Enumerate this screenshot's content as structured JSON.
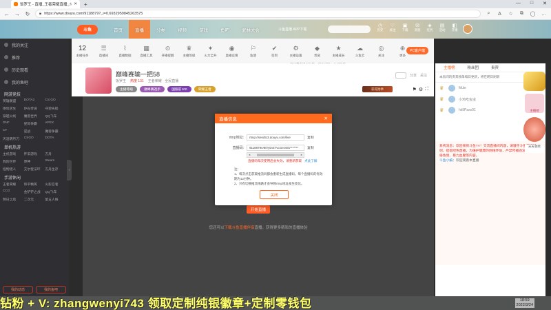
{
  "browser": {
    "tab_title": "饭罗王 - 直播_王者荣耀直播_斗鱼",
    "url": "https://www.douyu.com/9118879?_i=0.6932959845263575",
    "new_tab": "+",
    "minimize": "—",
    "maximize": "□",
    "close": "✕"
  },
  "site": {
    "logo": "斗鱼",
    "nav": [
      "首页",
      "直播",
      "分类",
      "视频",
      "游戏",
      "鱼吧",
      "武林大会"
    ],
    "download_label": "斗鱼直播 APP下载",
    "search_placeholder": "",
    "header_icons": [
      {
        "glyph": "◷",
        "label": "历史"
      },
      {
        "glyph": "♡",
        "label": "关注"
      },
      {
        "glyph": "▣",
        "label": "下载"
      },
      {
        "glyph": "✉",
        "label": "消息"
      },
      {
        "glyph": "◈",
        "label": "任务"
      },
      {
        "glyph": "▤",
        "label": "活动"
      },
      {
        "glyph": "◧",
        "label": "开播"
      }
    ]
  },
  "sidebar": {
    "items": [
      "我的关注",
      "推荐",
      "历史观看",
      "我的鱼吧"
    ],
    "section1": "网游竞技",
    "grid1": [
      "英雄联盟",
      "DOTA2",
      "CS:GO",
      "绝地求生",
      "炉石传说",
      "守望先锋",
      "穿越火线",
      "魔兽世界",
      "QQ飞车",
      "DNF",
      "星际争霸",
      "APEX",
      "CF",
      "逆战",
      "魔兽争霸",
      "天涯明月刀",
      "CSGO",
      "DOTA"
    ],
    "section2": "单机热游",
    "grid2": [
      "主机游戏",
      "怀旧游戏",
      "方舟",
      "我的世界",
      "原神",
      "Steam",
      "怪物猎人",
      "艾尔登法环",
      "方舟生存"
    ],
    "section3": "手游休闲",
    "grid3": [
      "王者荣耀",
      "和平精英",
      "火影忍者",
      "CCG",
      "金铲铲之战",
      "QQ飞车",
      "明日之后",
      "二次元",
      "第五人格"
    ],
    "bottom_buttons": [
      "我的动态",
      "我的鱼吧"
    ],
    "collapse": "‹"
  },
  "catbar": {
    "count": "12",
    "count_label": "主播任务",
    "items": [
      {
        "glyph": "☰",
        "label": "直播间"
      },
      {
        "glyph": "⌇",
        "label": "直播数据"
      },
      {
        "glyph": "▦",
        "label": "直播工具"
      },
      {
        "glyph": "⊙",
        "label": "开播提醒"
      },
      {
        "glyph": "♛",
        "label": "主播等级"
      },
      {
        "glyph": "✦",
        "label": "火力全开"
      },
      {
        "glyph": "◉",
        "label": "直播竞猜"
      },
      {
        "glyph": "⚐",
        "label": "鱼塘"
      },
      {
        "glyph": "✔",
        "label": "签到"
      },
      {
        "glyph": "⚙",
        "label": "主播设置"
      },
      {
        "glyph": "◆",
        "label": "贵族"
      },
      {
        "glyph": "★",
        "label": "主播成长"
      },
      {
        "glyph": "☁",
        "label": "斗鱼云"
      },
      {
        "glyph": "◎",
        "label": "关注"
      },
      {
        "glyph": "⊕",
        "label": "更多"
      }
    ],
    "tip": "已设置直播间标题，建议填写一个好听的标题",
    "pc_pill": "PC客户端"
  },
  "room": {
    "title": "巅峰赛输一把58",
    "id": "房间号",
    "anchor": "饭罗王",
    "hot": "热度 131",
    "sub": "王者荣耀 · 全民直播",
    "tags": [
      "主播等级",
      "巅峰赛选手",
      "国服前100",
      "荣耀王者"
    ],
    "follow": "关注",
    "banner": "获得勋章",
    "share": "分享"
  },
  "player": {
    "start_button": "开始直播",
    "msg_pre": "您还可以",
    "msg_hl": "下载斗鱼直播伴侣",
    "msg_post": "直播，获得更多精彩的直播体验"
  },
  "modal": {
    "title": "直播信息",
    "close": "✕",
    "rtmp_label": "rtmp地址:",
    "rtmp_value": "rtmp://sendtc3.douyu.com/live",
    "key_label": "直播码:",
    "key_value": "9118879rv8tTyDotTvcGezs6s*******",
    "copy": "复制",
    "warn": "直播码每次使用后会失效，请重新获取",
    "warn_link": "点此了解",
    "notes_title": "注：",
    "notes": [
      "1、每次点击获取推流码都会重新生成直播码，每个直播码的有效期为12分钟。",
      "2、只有切换推流线路才会导致rtmp地址发生变化。"
    ],
    "ok": "关闭"
  },
  "rpanel": {
    "tabs": [
      "主播榜",
      "粉丝团",
      "贵宾"
    ],
    "note": "本房间的贵宾榜单每日更新，将在明日刷新",
    "ranks": [
      {
        "medal": "♛",
        "name": "Mule",
        "val": "41"
      },
      {
        "medal": "♛",
        "name": "小鸡吃虫虫",
        "val": "35"
      },
      {
        "medal": "♛",
        "name": "hk9Paxs01",
        "val": "20"
      }
    ],
    "chat_sys": "系统消息：欢迎来到斗鱼TV！交流直播间内容，请遵守斗鱼直播规则，提倡绿色直播，为维护健康的网络环境，严禁传播违法违规、低俗色情、暴力血腥等内容。",
    "chat_name": "斗鱼小编：",
    "chat_msg": "欢迎观看本直播"
  },
  "floats": {
    "b": "主播榜",
    "d": "天天领奖"
  },
  "overlay": {
    "text": "钻粉 + V: zhangwenyi743 领取定制纯银徽章+定制零钱包"
  },
  "clock": {
    "time": "18:59",
    "date": "2022/3/24"
  }
}
